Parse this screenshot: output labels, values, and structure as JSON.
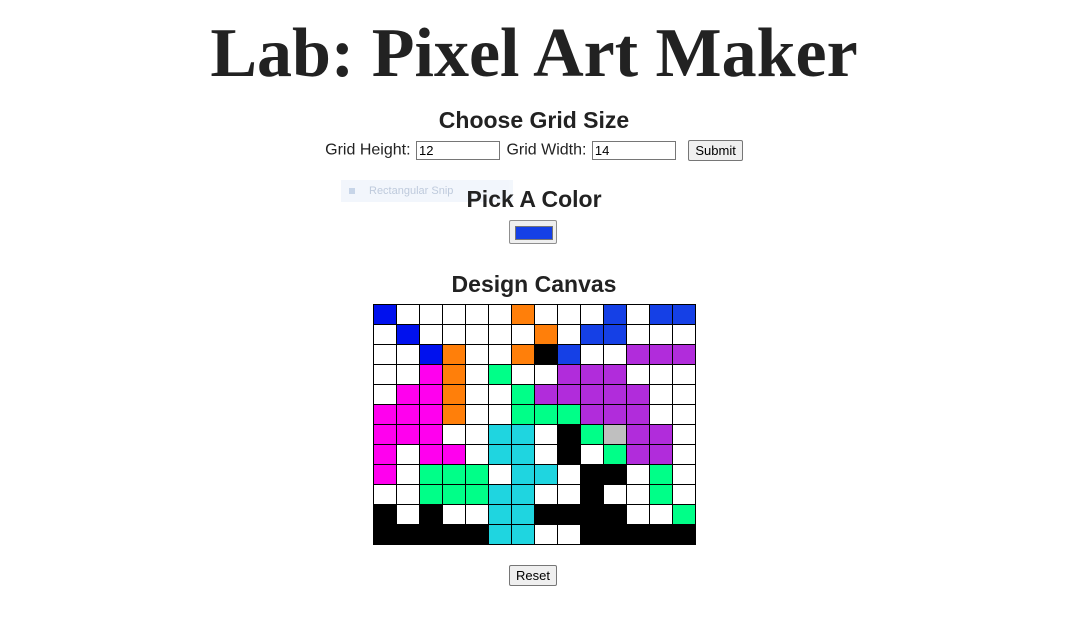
{
  "title": "Lab: Pixel Art Maker",
  "grid_size": {
    "heading": "Choose Grid Size",
    "height_label": "Grid Height:",
    "height_value": "12",
    "width_label": "Grid Width:",
    "width_value": "14",
    "submit_label": "Submit"
  },
  "snip_overlay": {
    "label": "Rectangular Snip"
  },
  "color": {
    "heading": "Pick A Color",
    "current": "#1540e6"
  },
  "canvas": {
    "heading": "Design Canvas",
    "rows": 12,
    "cols": 14,
    "palette": {
      ".": "#ffffff",
      "b": "#0011ee",
      "B": "#1540e6",
      "o": "#ff7f0a",
      "k": "#000000",
      "p": "#b12cdb",
      "g": "#00ff88",
      "m": "#ff00ee",
      "c": "#1fd5e0",
      "s": "#bfbfbf"
    },
    "pixels": [
      "b.....o...B.BB",
      ".b.....o.BB...",
      "..bo..okB..pppp",
      "..mo.g..ppp..",
      ".mmo..gppppp..",
      "mmmo..gggppp..",
      "mmm..cc.kgspp.",
      "m.mm.cc.k.gpp.",
      "m.ggg.cc.kk.g..",
      "..gggcc..k..g.",
      "k.k..cckkkk..g",
      "kkkkkcc..kkkkk"
    ]
  },
  "reset_label": "Reset"
}
